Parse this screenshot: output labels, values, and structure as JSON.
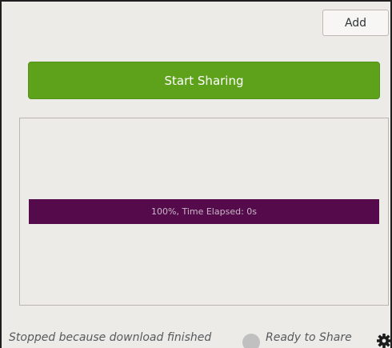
{
  "toolbar": {
    "add_label": "Add"
  },
  "main": {
    "start_label": "Start Sharing",
    "progress": {
      "percent": 100,
      "text": "100%, Time Elapsed: 0s"
    }
  },
  "status_bar": {
    "message": "Stopped because download finished",
    "server_status": "Ready to Share",
    "settings_icon": "gear-icon"
  },
  "colors": {
    "start_button": "#5ea21c",
    "progress_fill": "#550a4c",
    "status_dot": "#c0c0c0"
  }
}
